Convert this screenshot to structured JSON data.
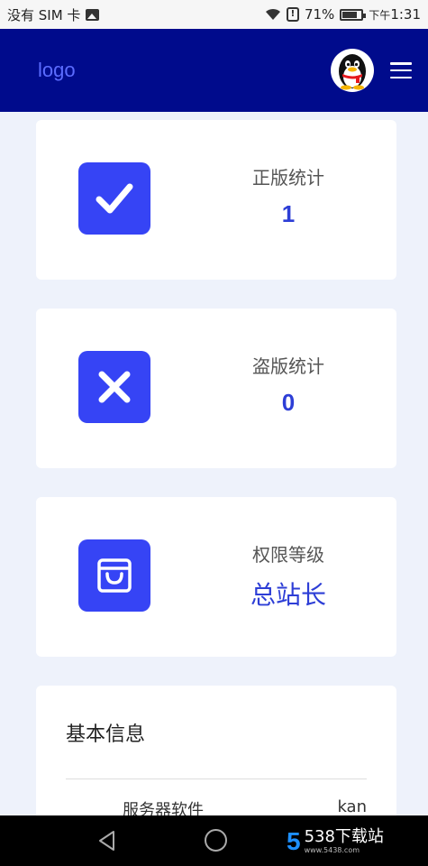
{
  "status_bar": {
    "carrier": "没有 SIM 卡",
    "battery": "71%",
    "period": "下午",
    "time": "1:31"
  },
  "header": {
    "logo": "logo",
    "avatar_icon": "qq-penguin-icon",
    "menu_icon": "hamburger-menu-icon"
  },
  "stats": [
    {
      "label": "正版统计",
      "value": "1",
      "icon": "check-icon"
    },
    {
      "label": "盗版统计",
      "value": "0",
      "icon": "close-x-icon"
    },
    {
      "label": "权限等级",
      "value": "总站长",
      "icon": "shopping-bag-icon"
    }
  ],
  "info": {
    "title": "基本信息",
    "rows": [
      {
        "key": "服务器软件",
        "value": "kan"
      }
    ]
  },
  "watermark": {
    "logo": "5",
    "text": "538下载站",
    "url": "www.5438.com"
  },
  "colors": {
    "header_bg": "#000b8c",
    "accent": "#3644f5",
    "value_text": "#2d3ed6",
    "page_bg": "#eef2fb"
  }
}
